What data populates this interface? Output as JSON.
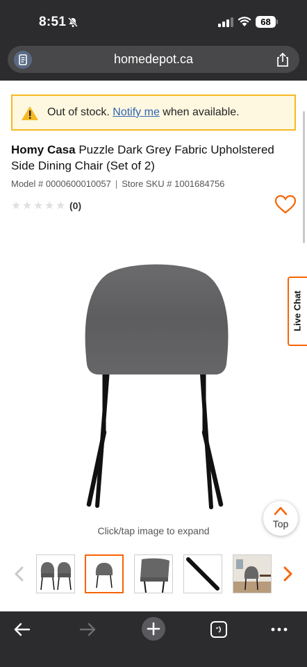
{
  "status_bar": {
    "time": "8:51",
    "battery": "68"
  },
  "browser": {
    "url": "homedepot.ca"
  },
  "alert": {
    "prefix": "Out of stock. ",
    "link": "Notify me",
    "suffix": " when available."
  },
  "product": {
    "brand": "Homy Casa",
    "name": " Puzzle Dark Grey Fabric Upholstered Side Dining Chair (Set of 2)",
    "model_label": "Model # 0000600010057",
    "separator": "|",
    "sku_label": "Store SKU # 1001684756",
    "rating_count": "(0)",
    "rating_stars": 0
  },
  "live_chat": {
    "label": "Live Chat"
  },
  "back_to_top": {
    "label": "Top"
  },
  "gallery": {
    "expand_hint": "Click/tap image to expand",
    "thumbnails": [
      "pair-front",
      "back-view",
      "side-view",
      "leg-detail",
      "room-scene"
    ],
    "active_index": 1
  },
  "colors": {
    "accent": "#f96302",
    "link": "#2d64b4",
    "alert_bg": "#fff8e1",
    "alert_border": "#f5b921",
    "chrome": "#2c2c2e"
  },
  "icons": [
    "bell-off-icon",
    "signal-icon",
    "wifi-icon",
    "battery-icon",
    "reader-icon",
    "share-icon",
    "warning-icon",
    "heart-icon",
    "chevron-up-icon",
    "chevron-left-icon",
    "chevron-right-icon",
    "back-icon",
    "forward-icon",
    "new-tab-icon",
    "tabs-icon",
    "more-icon"
  ]
}
